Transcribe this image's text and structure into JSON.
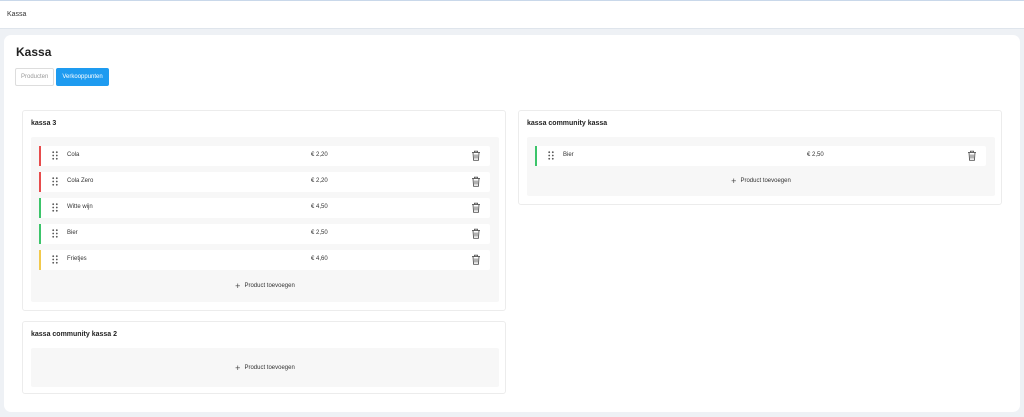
{
  "topbar": {
    "title": "Kassa"
  },
  "page": {
    "title": "Kassa",
    "tabs": [
      {
        "label": "Producten",
        "active": false
      },
      {
        "label": "Verkooppunten",
        "active": true
      }
    ]
  },
  "icons": {
    "drag": "drag-handle-icon",
    "trash": "trash-icon",
    "add": "plus-icon"
  },
  "colors": {
    "accent": "#1e9bf0",
    "red": "#e74c4c",
    "green": "#3cc46a",
    "yellow": "#f2c94c"
  },
  "points": [
    {
      "title": "kassa 3",
      "add_label": "Product toevoegen",
      "items": [
        {
          "name": "Cola",
          "price": "€ 2,20",
          "color": "#e74c4c"
        },
        {
          "name": "Cola Zero",
          "price": "€ 2,20",
          "color": "#e74c4c"
        },
        {
          "name": "Witte wijn",
          "price": "€ 4,50",
          "color": "#3cc46a"
        },
        {
          "name": "Bier",
          "price": "€ 2,50",
          "color": "#3cc46a"
        },
        {
          "name": "Frietjes",
          "price": "€ 4,60",
          "color": "#f2c94c"
        }
      ]
    },
    {
      "title": "kassa community kassa",
      "add_label": "Product toevoegen",
      "items": [
        {
          "name": "Bier",
          "price": "€ 2,50",
          "color": "#3cc46a"
        }
      ]
    },
    {
      "title": "kassa community kassa 2",
      "add_label": "Product toevoegen",
      "items": []
    }
  ]
}
